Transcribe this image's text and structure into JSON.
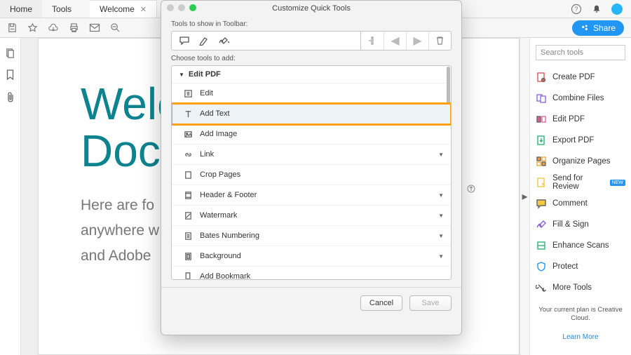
{
  "menubar": {
    "home": "Home",
    "tools": "Tools"
  },
  "tab": {
    "title": "Welcome"
  },
  "toolbar": {
    "share": "Share"
  },
  "document": {
    "heading_line1": "Welc",
    "heading_line2": "Docu",
    "paragraph_line1": "Here are fo",
    "paragraph_line2": "anywhere w",
    "paragraph_line3": "and Adobe"
  },
  "dialog": {
    "title": "Customize Quick Tools",
    "top_label": "Tools to show in Toolbar:",
    "choose_label": "Choose tools to add:",
    "category": "Edit PDF",
    "items": [
      "Edit",
      "Add Text",
      "Add Image",
      "Link",
      "Crop Pages",
      "Header & Footer",
      "Watermark",
      "Bates Numbering",
      "Background",
      "Add Bookmark"
    ],
    "cancel": "Cancel",
    "save": "Save"
  },
  "right_panel": {
    "search_placeholder": "Search tools",
    "tools": [
      "Create PDF",
      "Combine Files",
      "Edit PDF",
      "Export PDF",
      "Organize Pages",
      "Send for Review",
      "Comment",
      "Fill & Sign",
      "Enhance Scans",
      "Protect",
      "More Tools"
    ],
    "new_badge": "NEW",
    "plan_note": "Your current plan is Creative Cloud.",
    "learn_more": "Learn More"
  }
}
